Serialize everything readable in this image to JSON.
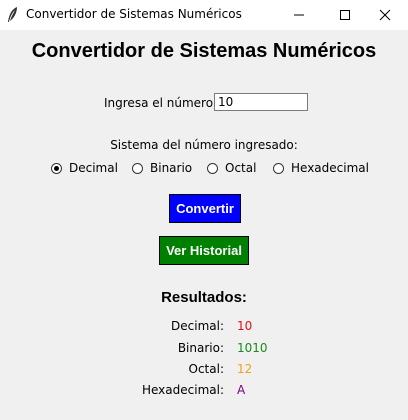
{
  "window": {
    "title": "Convertidor de Sistemas Numéricos",
    "icon": "feather-icon"
  },
  "main": {
    "heading": "Convertidor de Sistemas Numéricos",
    "number_label": "Ingresa el número:",
    "number_value": "10",
    "system_label": "Sistema del número ingresado:",
    "systems": [
      {
        "label": "Decimal",
        "selected": true
      },
      {
        "label": "Binario",
        "selected": false
      },
      {
        "label": "Octal",
        "selected": false
      },
      {
        "label": "Hexadecimal",
        "selected": false
      }
    ],
    "convert_label": "Convertir",
    "history_label": "Ver Historial"
  },
  "results": {
    "heading": "Resultados:",
    "rows": [
      {
        "label": "Decimal:",
        "value": "10",
        "color": "#e01010"
      },
      {
        "label": "Binario:",
        "value": "1010",
        "color": "#1a8a1a"
      },
      {
        "label": "Octal:",
        "value": "12",
        "color": "#f0a020"
      },
      {
        "label": "Hexadecimal:",
        "value": "A",
        "color": "#800080"
      }
    ]
  },
  "colors": {
    "convert_button": "#0000ff",
    "history_button": "#008000",
    "background": "#f0f0f0"
  }
}
